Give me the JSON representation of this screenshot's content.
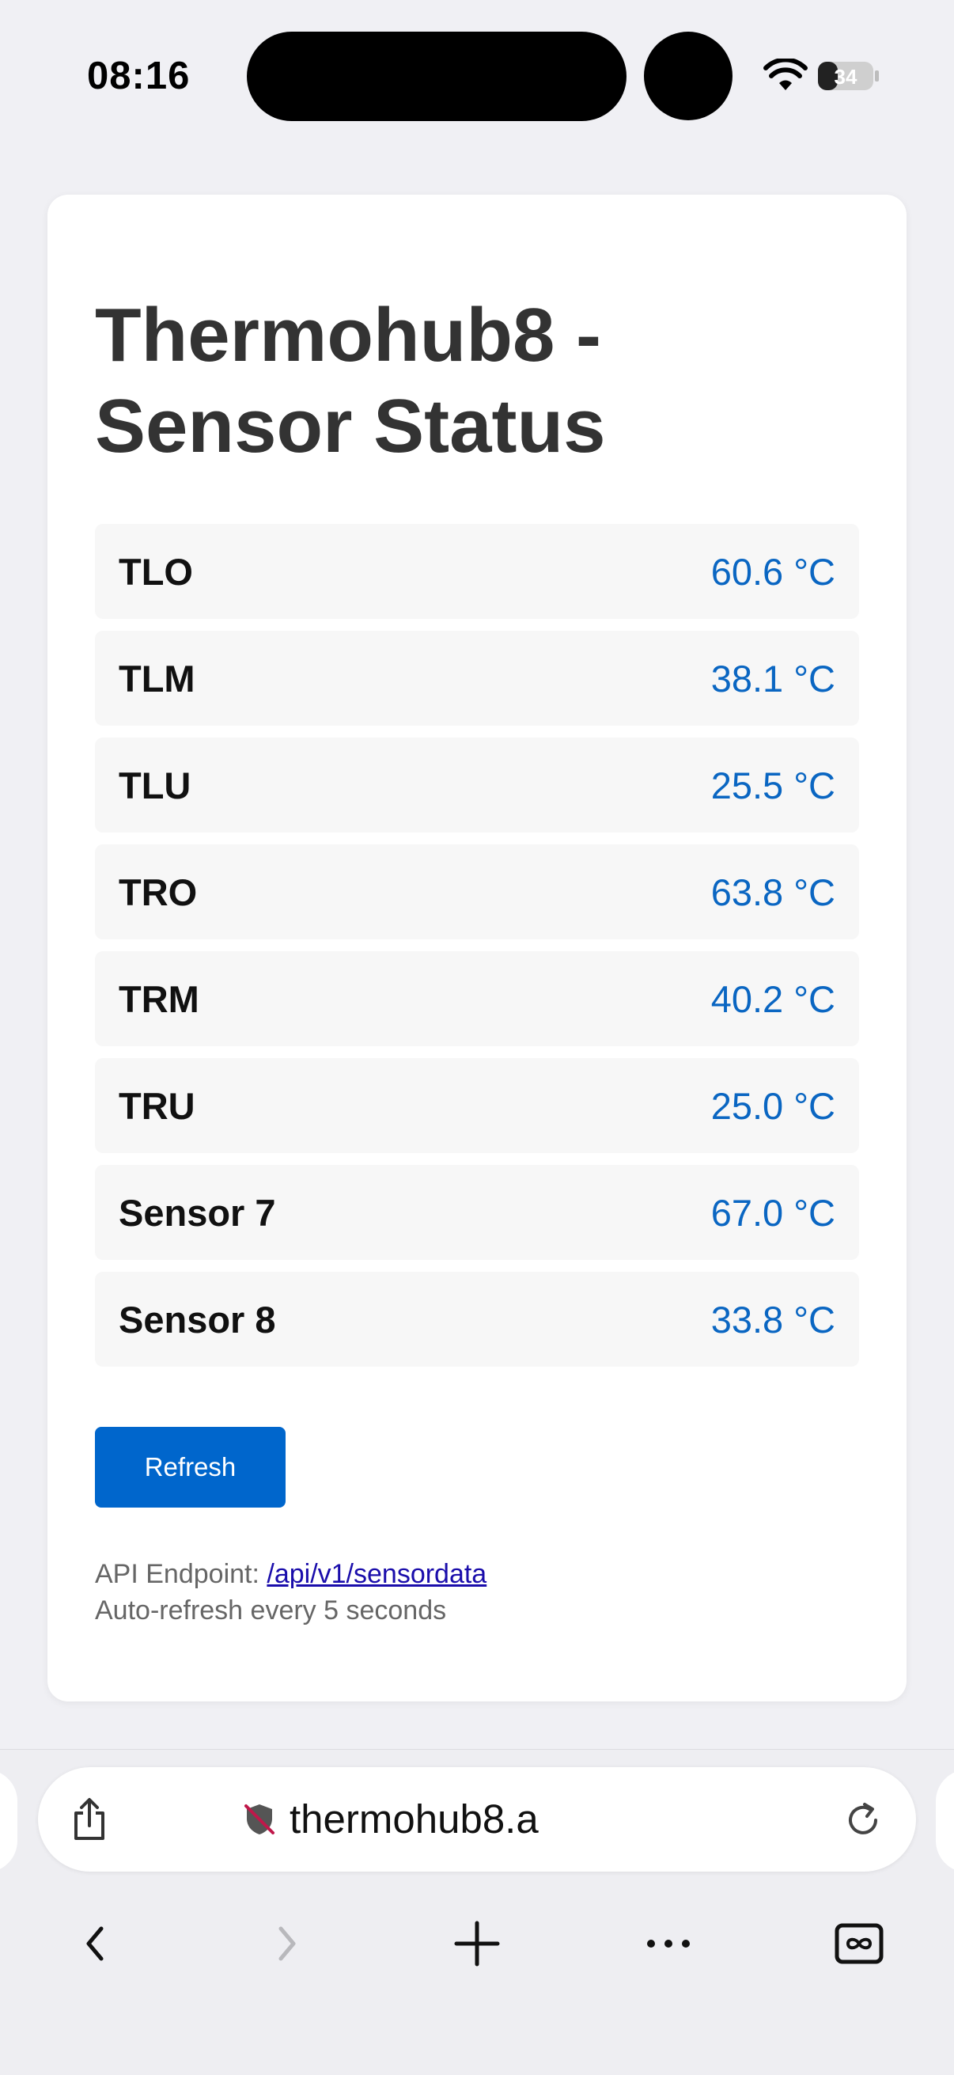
{
  "status_bar": {
    "time": "08:16",
    "battery_level": "34"
  },
  "page": {
    "title": "Thermohub8 - Sensor Status",
    "sensors": [
      {
        "name": "TLO",
        "value": "60.6 °C"
      },
      {
        "name": "TLM",
        "value": "38.1 °C"
      },
      {
        "name": "TLU",
        "value": "25.5 °C"
      },
      {
        "name": "TRO",
        "value": "63.8 °C"
      },
      {
        "name": "TRM",
        "value": "40.2 °C"
      },
      {
        "name": "TRU",
        "value": "25.0 °C"
      },
      {
        "name": "Sensor 7",
        "value": "67.0 °C"
      },
      {
        "name": "Sensor 8",
        "value": "33.8 °C"
      }
    ],
    "refresh_label": "Refresh",
    "api_label": "API Endpoint:",
    "api_link": "/api/v1/sensordata",
    "auto_refresh_text": "Auto-refresh every 5 seconds"
  },
  "browser": {
    "url": "thermohub8.a",
    "icons": [
      "share-icon",
      "privacy-icon",
      "reload-icon",
      "back-icon",
      "forward-icon",
      "new-tab-icon",
      "more-icon",
      "tabs-icon"
    ]
  },
  "colors": {
    "accent": "#0066cc",
    "value_text": "#0a66c2",
    "background": "#f0f0f4"
  }
}
